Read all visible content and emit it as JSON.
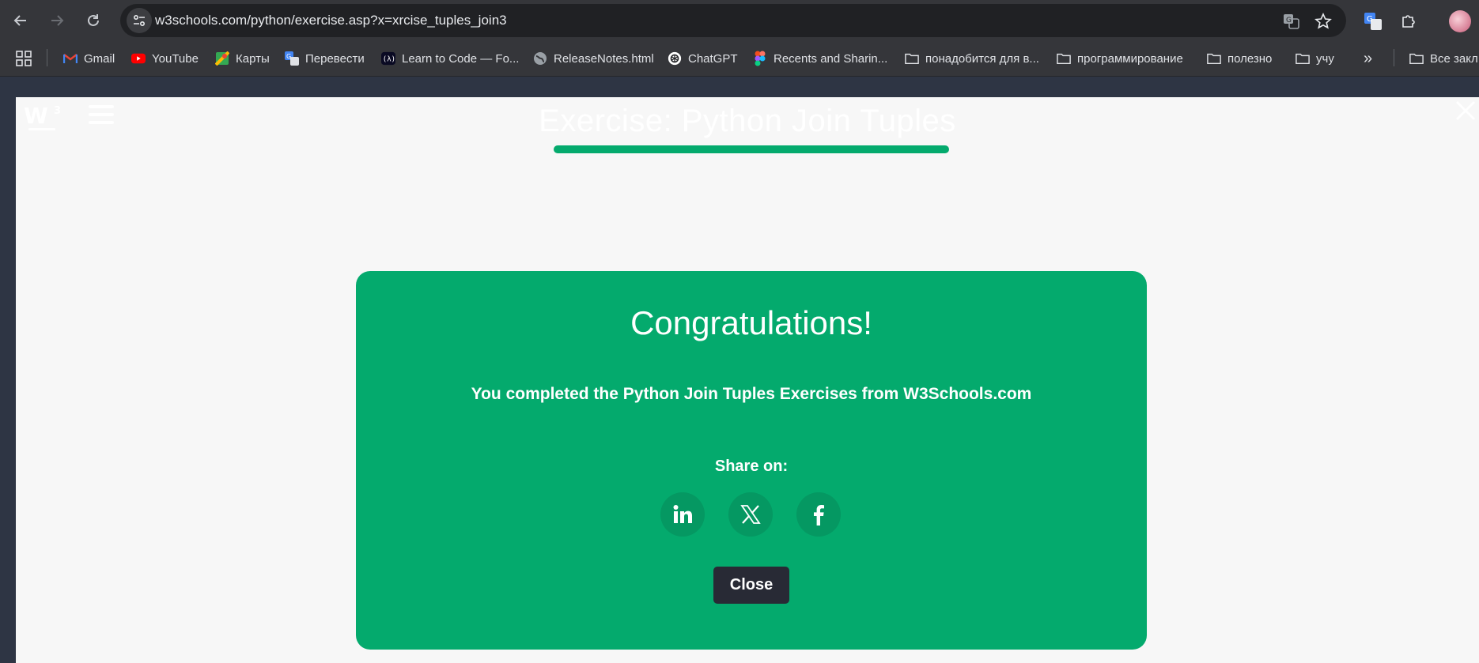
{
  "browser": {
    "url": "w3schools.com/python/exercise.asp?x=xrcise_tuples_join3",
    "bookmarks": [
      {
        "label": "Gmail",
        "icon": "gmail-icon"
      },
      {
        "label": "YouTube",
        "icon": "youtube-icon"
      },
      {
        "label": "Карты",
        "icon": "maps-icon"
      },
      {
        "label": "Перевести",
        "icon": "translate-icon"
      },
      {
        "label": "Learn to Code — Fo...",
        "icon": "freecodecamp-icon"
      },
      {
        "label": "ReleaseNotes.html",
        "icon": "globe-icon"
      },
      {
        "label": "ChatGPT",
        "icon": "chatgpt-icon"
      },
      {
        "label": "Recents and Sharin...",
        "icon": "figma-icon"
      },
      {
        "label": "понадобится для в...",
        "icon": "folder-icon"
      },
      {
        "label": "программирование",
        "icon": "folder-icon"
      },
      {
        "label": "полезно",
        "icon": "folder-icon"
      },
      {
        "label": "учу",
        "icon": "folder-icon"
      }
    ],
    "overflow_label": "»",
    "all_bookmarks_label": "Все закл"
  },
  "page": {
    "title": "Exercise: Python Join Tuples",
    "progress_fraction": 1.0,
    "accent_color": "#04aa6d"
  },
  "modal": {
    "heading": "Congratulations!",
    "message": "You completed the Python Join Tuples Exercises from W3Schools.com",
    "share_label": "Share on:",
    "share_targets": [
      "linkedin-icon",
      "x-icon",
      "facebook-icon"
    ],
    "close_label": "Close",
    "background_color": "#04aa6d",
    "button_color": "#282a35"
  }
}
